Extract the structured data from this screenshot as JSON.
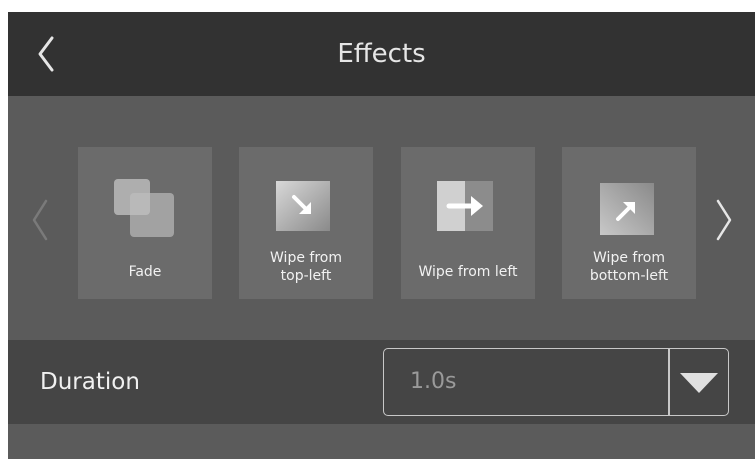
{
  "header": {
    "title": "Effects",
    "back_icon": "chevron-left-icon"
  },
  "carousel": {
    "prev_icon": "chevron-left-icon",
    "next_icon": "chevron-right-icon",
    "items": [
      {
        "label": "Fade",
        "icon": "fade-icon"
      },
      {
        "label": "Wipe from\ntop-left",
        "icon": "arrow-down-right-icon"
      },
      {
        "label": "Wipe from left",
        "icon": "arrow-right-icon"
      },
      {
        "label": "Wipe from\nbottom-left",
        "icon": "arrow-up-right-icon"
      }
    ]
  },
  "duration": {
    "label": "Duration",
    "value": "1.0s",
    "caret_icon": "caret-down-icon"
  },
  "colors": {
    "header_bg": "#323232",
    "panel_bg": "#5b5b5b",
    "tile_bg": "#6b6b6b",
    "duration_bg": "#454545",
    "text": "#e6e6e6",
    "muted_text": "#9a9a9a",
    "border": "#c8c8c8"
  }
}
